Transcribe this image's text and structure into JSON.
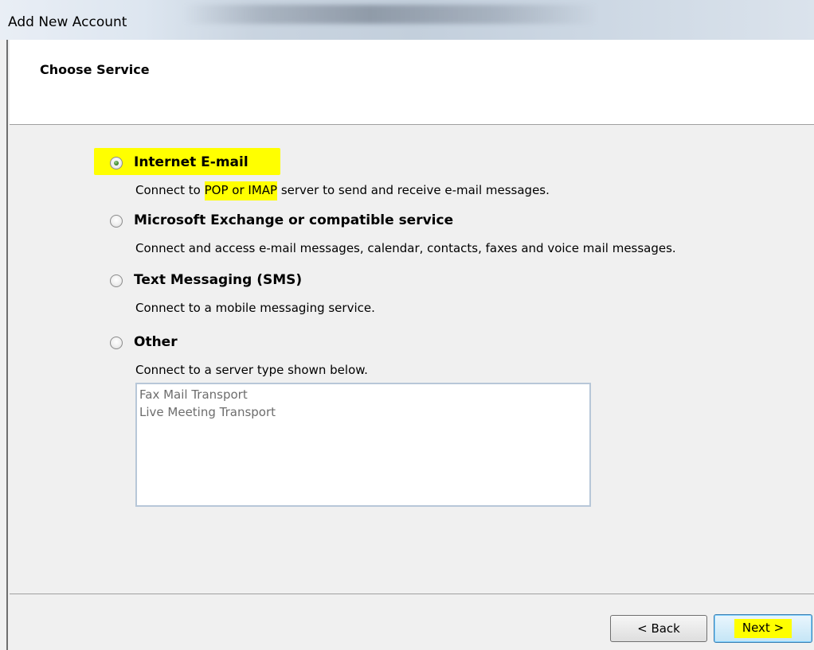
{
  "window": {
    "title": "Add New Account"
  },
  "header": {
    "title": "Choose Service"
  },
  "options": [
    {
      "label": "Internet E-mail",
      "checked": true,
      "description_pre": "Connect to ",
      "description_hl": "POP or IMAP",
      "description_post": " server to send and receive e-mail messages."
    },
    {
      "label": "Microsoft Exchange or compatible service",
      "checked": false,
      "description": "Connect and access e-mail messages, calendar, contacts, faxes and voice mail messages."
    },
    {
      "label": "Text Messaging (SMS)",
      "checked": false,
      "description": "Connect to a mobile messaging service."
    },
    {
      "label": "Other",
      "checked": false,
      "description": "Connect to a server type shown below."
    }
  ],
  "server_types": [
    "Fax Mail Transport",
    "Live Meeting Transport"
  ],
  "buttons": {
    "back": "< Back",
    "next": "Next >"
  },
  "colors": {
    "highlight": "#ffff00",
    "title_bar": "#dde6f0"
  }
}
